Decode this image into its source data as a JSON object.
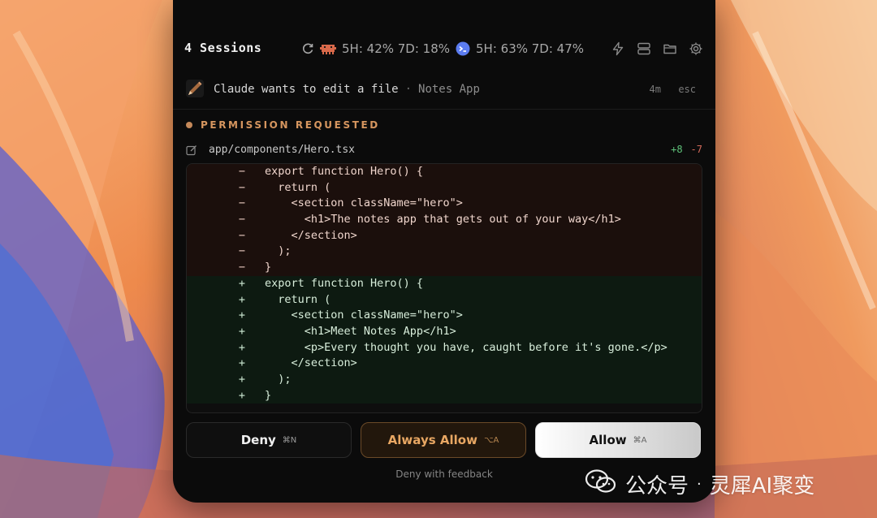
{
  "header": {
    "sessions_label": "4 Sessions",
    "usage_a": "5H: 42% 7D: 18%",
    "usage_b": "5H: 63% 7D: 47%",
    "icons": [
      "refresh-icon",
      "claude-agent-icon",
      "codex-agent-icon",
      "bolt-icon",
      "stack-icon",
      "folder-icon",
      "gear-icon"
    ]
  },
  "notification": {
    "message": "Claude wants to edit a file",
    "separator": "·",
    "app": "Notes App",
    "time": "4m",
    "dismiss": "esc"
  },
  "permission": {
    "title": "PERMISSION REQUESTED",
    "file_path": "app/components/Hero.tsx",
    "additions": "+8",
    "deletions": "-7"
  },
  "diff": {
    "lines": [
      {
        "type": "del",
        "sign": "−",
        "code": "export function Hero() {"
      },
      {
        "type": "del",
        "sign": "−",
        "code": "  return ("
      },
      {
        "type": "del",
        "sign": "−",
        "code": "    <section className=\"hero\">"
      },
      {
        "type": "del",
        "sign": "−",
        "code": "      <h1>The notes app that gets out of your way</h1>"
      },
      {
        "type": "del",
        "sign": "−",
        "code": "    </section>"
      },
      {
        "type": "del",
        "sign": "−",
        "code": "  );"
      },
      {
        "type": "del",
        "sign": "−",
        "code": "}"
      },
      {
        "type": "add",
        "sign": "+",
        "code": "export function Hero() {"
      },
      {
        "type": "add",
        "sign": "+",
        "code": "  return ("
      },
      {
        "type": "add",
        "sign": "+",
        "code": "    <section className=\"hero\">"
      },
      {
        "type": "add",
        "sign": "+",
        "code": "      <h1>Meet Notes App</h1>"
      },
      {
        "type": "add",
        "sign": "+",
        "code": "      <p>Every thought you have, caught before it's gone.</p>"
      },
      {
        "type": "add",
        "sign": "+",
        "code": "    </section>"
      },
      {
        "type": "add",
        "sign": "+",
        "code": "  );"
      },
      {
        "type": "add",
        "sign": "+",
        "code": "}"
      }
    ]
  },
  "buttons": {
    "deny_label": "Deny",
    "deny_shortcut": "⌘N",
    "always_label": "Always Allow",
    "always_shortcut": "⌥A",
    "allow_label": "Allow",
    "allow_shortcut": "⌘A"
  },
  "feedback_label": "Deny with feedback",
  "watermark": {
    "text_a": "公众号",
    "text_sep": "·",
    "text_b": "灵犀AI聚变"
  },
  "colors": {
    "accent_orange": "#d6965f",
    "diff_add": "#5fc27a",
    "diff_del": "#d36a5a",
    "panel_bg": "#0b0b0b"
  }
}
